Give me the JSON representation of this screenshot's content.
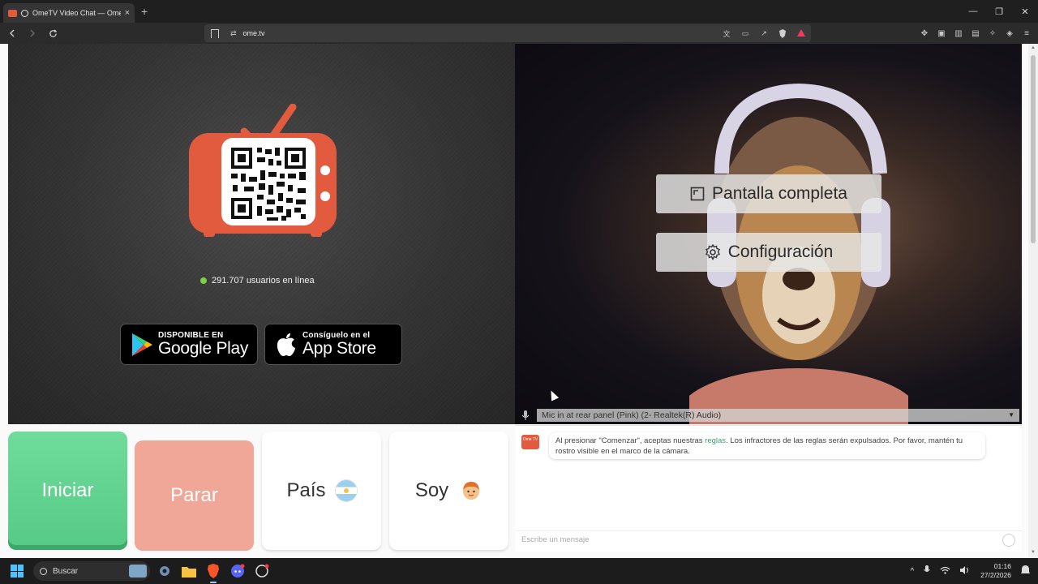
{
  "browser": {
    "tab_title": "OmeTV Video Chat — Omeg",
    "tab_close": "×",
    "new_tab": "+",
    "url": "ome.tv",
    "window_controls": [
      "—",
      "❐",
      "✕"
    ]
  },
  "page": {
    "online_count": "291.707 usuarios en línea",
    "google_play": {
      "small": "DISPONIBLE EN",
      "big": "Google Play"
    },
    "app_store": {
      "small": "Consíguelo en el",
      "big": "App Store"
    },
    "video_controls": {
      "fullscreen": "Pantalla completa",
      "settings": "Configuración"
    },
    "mic_select": "Mic in at rear panel (Pink) (2- Realtek(R) Audio)",
    "buttons": {
      "start": "Iniciar",
      "stop": "Parar",
      "country": "País",
      "gender": "Soy"
    },
    "chat": {
      "logo": "Ome TV",
      "msg_pre": "Al presionar \"Comenzar\", aceptas nuestras ",
      "msg_link": "reglas",
      "msg_post": ". Los infractores de las reglas serán expulsados. Por favor, mantén tu rostro visible en el marco de la cámara.",
      "input_placeholder": "Escribe un mensaje"
    }
  },
  "taskbar": {
    "search_label": "Buscar",
    "time": "01:16",
    "date": "27/2/2026"
  },
  "colors": {
    "start": "#5fd08e",
    "stop": "#f0a797",
    "brand": "#e35b3e",
    "online_dot": "#7bd33c"
  }
}
